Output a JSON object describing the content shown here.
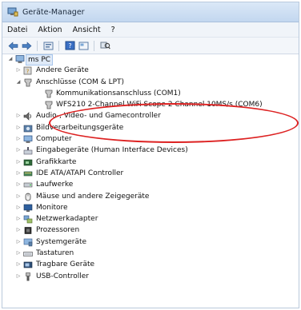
{
  "window": {
    "title": "Geräte-Manager"
  },
  "menu": [
    "Datei",
    "Aktion",
    "Ansicht",
    "?"
  ],
  "toolbar": [
    "back-icon",
    "forward-icon",
    "properties-icon",
    "help-icon",
    "view-icon",
    "scan-hardware-icon"
  ],
  "tree": {
    "root": "ms PC",
    "items": [
      {
        "label": "Andere Geräte",
        "icon": "other-devices-icon"
      },
      {
        "label": "Anschlüsse (COM & LPT)",
        "icon": "ports-icon",
        "expanded": true,
        "children": [
          {
            "label": "Kommunikationsanschluss (COM1)",
            "icon": "port-device-icon"
          },
          {
            "label": "WFS210 2-Channel WiFi Scope 2 Channel 10MS/s (COM6)",
            "icon": "port-device-icon"
          }
        ]
      },
      {
        "label": "Audio-, Video- und Gamecontroller",
        "icon": "audio-icon"
      },
      {
        "label": "Bildverarbeitungsgeräte",
        "icon": "imaging-icon"
      },
      {
        "label": "Computer",
        "icon": "computer-icon"
      },
      {
        "label": "Eingabegeräte (Human Interface Devices)",
        "icon": "hid-icon"
      },
      {
        "label": "Grafikkarte",
        "icon": "graphics-icon"
      },
      {
        "label": "IDE ATA/ATAPI Controller",
        "icon": "ide-icon"
      },
      {
        "label": "Laufwerke",
        "icon": "drive-icon"
      },
      {
        "label": "Mäuse und andere Zeigegeräte",
        "icon": "mouse-icon"
      },
      {
        "label": "Monitore",
        "icon": "monitor-icon"
      },
      {
        "label": "Netzwerkadapter",
        "icon": "network-icon"
      },
      {
        "label": "Prozessoren",
        "icon": "processor-icon"
      },
      {
        "label": "Systemgeräte",
        "icon": "system-icon"
      },
      {
        "label": "Tastaturen",
        "icon": "keyboard-icon"
      },
      {
        "label": "Tragbare Geräte",
        "icon": "portable-icon"
      },
      {
        "label": "USB-Controller",
        "icon": "usb-icon"
      }
    ]
  },
  "colors": {
    "annotation": "#dd2222",
    "selection": "#dfeaf8"
  }
}
